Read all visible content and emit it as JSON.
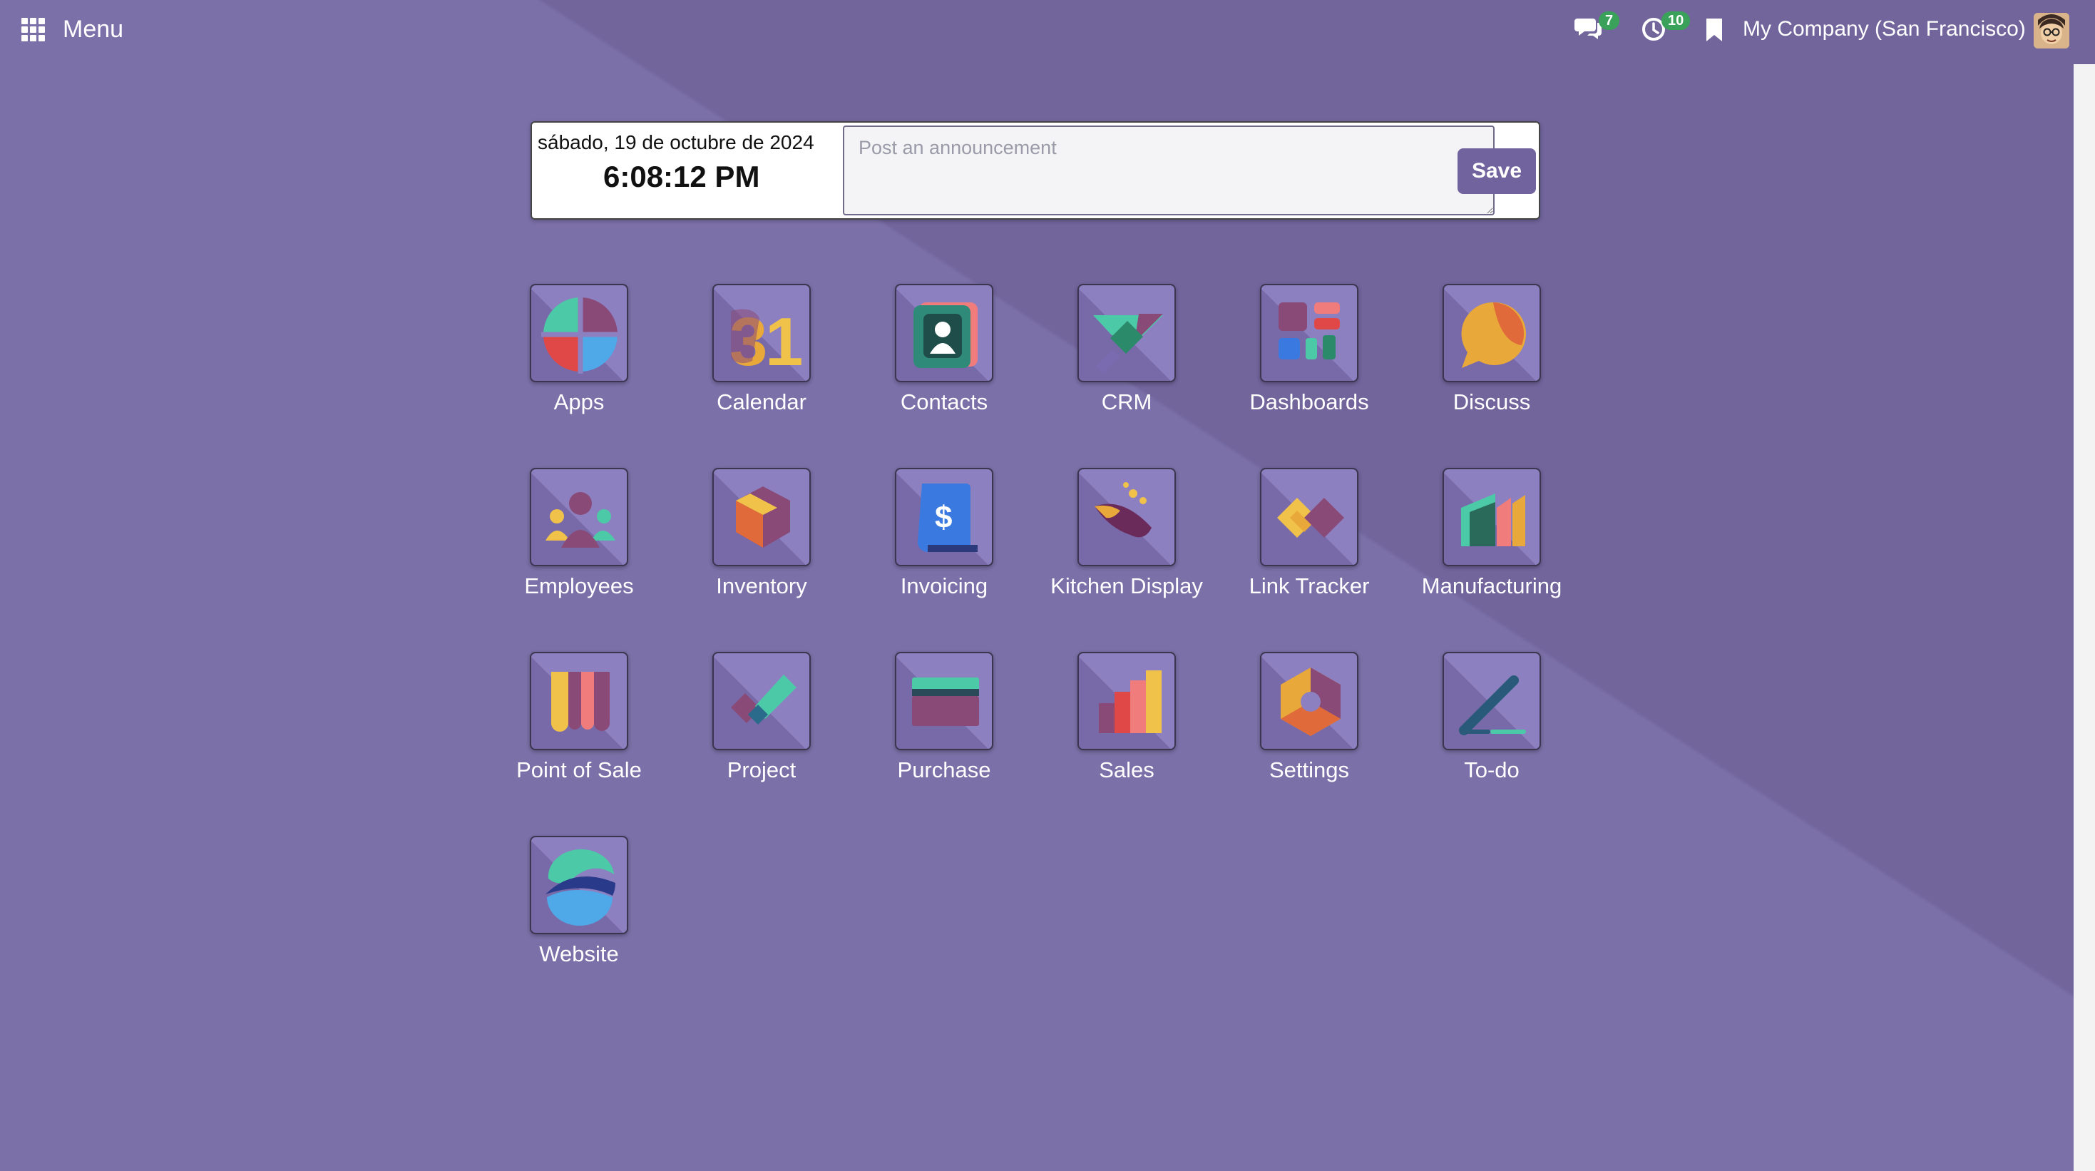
{
  "topbar": {
    "menu_label": "Menu",
    "chat_count": "7",
    "activity_count": "10",
    "company": "My Company (San Francisco)"
  },
  "announcement": {
    "date": "sábado, 19 de octubre de 2024",
    "time": "6:08:12 PM",
    "placeholder": "Post an announcement",
    "save_label": "Save"
  },
  "apps": [
    {
      "label": "Apps",
      "icon": "apps-icon"
    },
    {
      "label": "Calendar",
      "icon": "calendar-icon"
    },
    {
      "label": "Contacts",
      "icon": "contacts-icon"
    },
    {
      "label": "CRM",
      "icon": "crm-icon"
    },
    {
      "label": "Dashboards",
      "icon": "dashboards-icon"
    },
    {
      "label": "Discuss",
      "icon": "discuss-icon"
    },
    {
      "label": "Employees",
      "icon": "employees-icon"
    },
    {
      "label": "Inventory",
      "icon": "inventory-icon"
    },
    {
      "label": "Invoicing",
      "icon": "invoicing-icon"
    },
    {
      "label": "Kitchen Display",
      "icon": "kitchen-display-icon"
    },
    {
      "label": "Link Tracker",
      "icon": "link-tracker-icon"
    },
    {
      "label": "Manufacturing",
      "icon": "manufacturing-icon"
    },
    {
      "label": "Point of Sale",
      "icon": "point-of-sale-icon"
    },
    {
      "label": "Project",
      "icon": "project-icon"
    },
    {
      "label": "Purchase",
      "icon": "purchase-icon"
    },
    {
      "label": "Sales",
      "icon": "sales-icon"
    },
    {
      "label": "Settings",
      "icon": "settings-icon"
    },
    {
      "label": "To-do",
      "icon": "todo-icon"
    },
    {
      "label": "Website",
      "icon": "website-icon"
    }
  ],
  "colors": {
    "background": "#7b70a8",
    "save_button": "#71639e",
    "badge": "#3aa15a"
  }
}
